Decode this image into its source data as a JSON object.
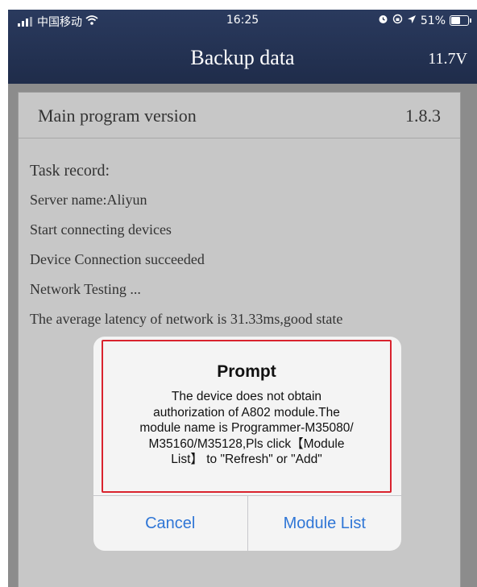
{
  "status_bar": {
    "carrier": "中国移动",
    "time": "16:25",
    "battery": "51%",
    "icons": [
      "signal-icon",
      "wifi-icon",
      "alarm-icon",
      "orientation-lock-icon",
      "location-icon",
      "battery-icon"
    ]
  },
  "header": {
    "title": "Backup data",
    "voltage": "11.7V"
  },
  "version": {
    "label": "Main program version",
    "value": "1.8.3"
  },
  "task_record": {
    "title": "Task record:",
    "lines": [
      "Server name:Aliyun",
      "Start connecting devices",
      "Device Connection succeeded",
      "Network Testing ...",
      "The average latency of network is 31.33ms,good state"
    ]
  },
  "dialog": {
    "title": "Prompt",
    "message_lines": [
      "The device does not obtain",
      "authorization of A802 module.The",
      "module name is Programmer-M35080/",
      "M35160/M35128,Pls click【Module",
      "List】 to \"Refresh\" or \"Add\""
    ],
    "cancel_label": "Cancel",
    "confirm_label": "Module List",
    "highlight_color": "#d9232e",
    "button_color": "#2f76d6"
  },
  "colors": {
    "nav_background": "#1f2c4a",
    "overlay_dim": "#8c8c8c"
  }
}
